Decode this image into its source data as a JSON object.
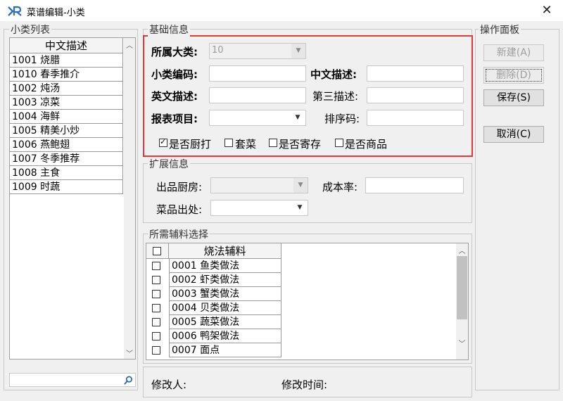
{
  "window": {
    "title": "菜谱编辑-小类",
    "close_glyph": "✕"
  },
  "left": {
    "group_label": "小类列表",
    "column_header": "中文描述",
    "rows": [
      "1001 烧腊",
      "1010 春季推介",
      "1002 炖汤",
      "1003 凉菜",
      "1004 海鲜",
      "1005 精美小炒",
      "1006 燕鲍翅",
      "1007 冬季推荐",
      "1008 主食",
      "1009 时蔬"
    ]
  },
  "basic": {
    "group_label": "基础信息",
    "category_label": "所属大类:",
    "category_value": "10",
    "code_label": "小类编码:",
    "cn_desc_label": "中文描述:",
    "en_desc_label": "英文描述:",
    "third_desc_label": "第三描述:",
    "report_label": "报表项目:",
    "sort_label": "排序码:",
    "checks": [
      {
        "label": "是否厨打",
        "checked": true
      },
      {
        "label": "套菜",
        "checked": false
      },
      {
        "label": "是否寄存",
        "checked": false
      },
      {
        "label": "是否商品",
        "checked": false
      }
    ],
    "highlight_color": "#e53935"
  },
  "ext": {
    "group_label": "扩展信息",
    "kitchen_label": "出品厨房:",
    "cost_label": "成本率:",
    "origin_label": "菜品出处:"
  },
  "aux": {
    "group_label": "所需辅料选择",
    "column_header": "烧法辅料",
    "rows": [
      "0001 鱼类做法",
      "0002 虾类做法",
      "0003 蟹类做法",
      "0004 贝类做法",
      "0005 蔬菜做法",
      "0006 鸭架做法",
      "0007 面点"
    ]
  },
  "footer": {
    "modifier_label": "修改人:",
    "modify_time_label": "修改时间:"
  },
  "ops": {
    "group_label": "操作面板",
    "new_label": "新建(A)",
    "delete_label": "删除(D)",
    "save_label": "保存(S)",
    "cancel_label": "取消(C)"
  },
  "icons": {
    "search": "search-icon",
    "dropdown": "chevron-down-icon",
    "app": "app-logo-icon"
  }
}
